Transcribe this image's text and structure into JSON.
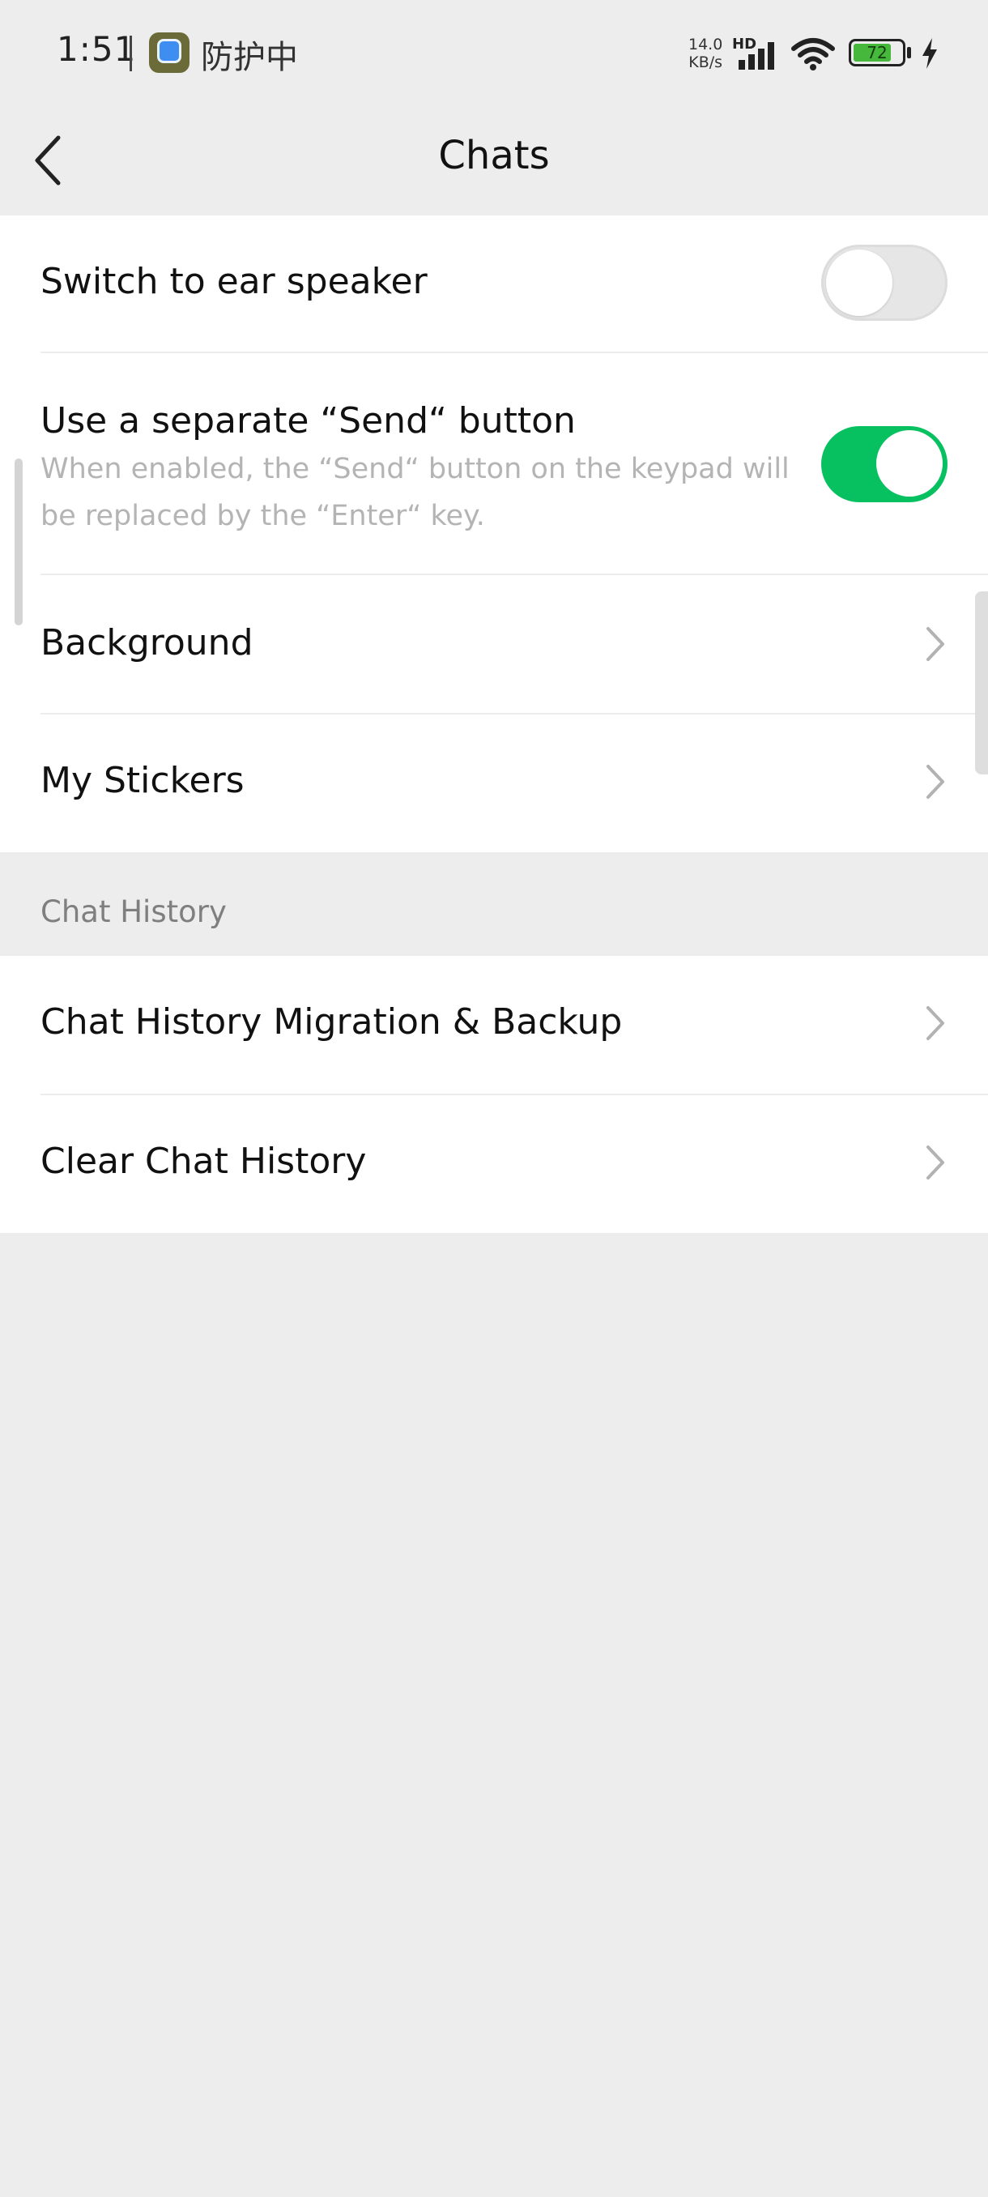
{
  "status_bar": {
    "time": "1:51",
    "app_status": "防护中",
    "net_speed_value": "14.0",
    "net_speed_unit": "KB/s",
    "hd_label": "HD",
    "battery_level": "72"
  },
  "nav": {
    "title": "Chats"
  },
  "settings": {
    "ear_speaker_label": "Switch to ear speaker",
    "ear_speaker_enabled": false,
    "send_button_label": "Use a separate “Send“ button",
    "send_button_desc": "When enabled, the “Send“ button on the keypad will be replaced by the “Enter“ key.",
    "send_button_enabled": true,
    "background_label": "Background",
    "stickers_label": "My Stickers"
  },
  "chat_history": {
    "section_title": "Chat History",
    "migration_label": "Chat History Migration & Backup",
    "clear_label": "Clear Chat History"
  },
  "colors": {
    "accent_green": "#07c160",
    "page_background": "#ededed"
  }
}
